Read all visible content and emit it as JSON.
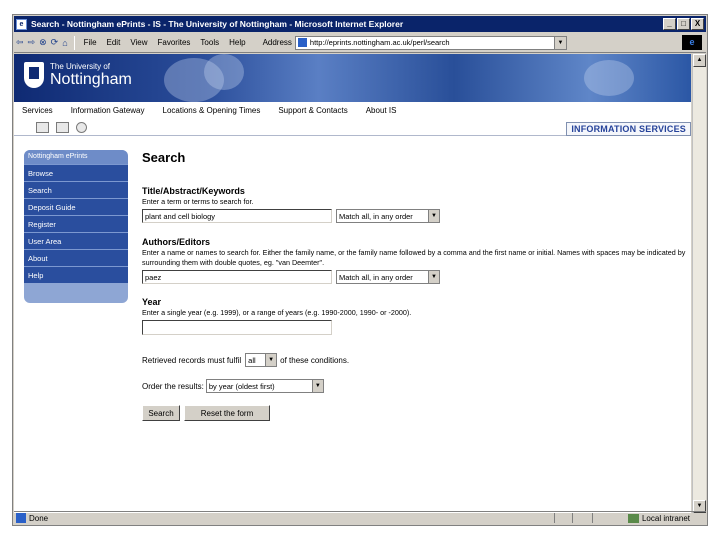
{
  "window": {
    "title": "Search - Nottingham ePrints - IS - The University of Nottingham - Microsoft Internet Explorer",
    "controls": [
      "_",
      "□",
      "X"
    ]
  },
  "toolbar": {
    "back": "⇦",
    "forward": "⇨",
    "stop": "⊗",
    "refresh": "⟳",
    "home": "⌂",
    "menus": [
      "File",
      "Edit",
      "View",
      "Favorites",
      "Tools",
      "Help"
    ],
    "address_label": "Address",
    "address_value": "http://eprints.nottingham.ac.uk/perl/search"
  },
  "banner": {
    "uni_top": "The University of",
    "uni_main": "Nottingham"
  },
  "linkbar": [
    "Services",
    "Information Gateway",
    "Locations & Opening Times",
    "Support & Contacts",
    "About IS"
  ],
  "is_label": "INFORMATION SERVICES",
  "sidebar": {
    "heading": "Nottingham ePrints",
    "items": [
      "Browse",
      "Search",
      "Deposit Guide",
      "Register",
      "User Area",
      "About",
      "Help"
    ]
  },
  "main": {
    "title": "Search",
    "title_section": {
      "heading": "Title/Abstract/Keywords",
      "help": "Enter a term or terms to search for.",
      "value": "plant and cell biology",
      "match": "Match all, in any order"
    },
    "authors_section": {
      "heading": "Authors/Editors",
      "help": "Enter a name or names to search for. Either the family name, or the family name followed by a comma and the first name or initial. Names with spaces may be indicated by surrounding them with double quotes, eg. \"van Deemter\".",
      "value": "paez",
      "match": "Match all, in any order"
    },
    "year_section": {
      "heading": "Year",
      "help": "Enter a single year (e.g. 1999), or a range of years (e.g. 1990-2000, 1990- or -2000).",
      "value": ""
    },
    "conditions": {
      "before": "Retrieved records must fulfil",
      "value": "all",
      "after": "of these conditions."
    },
    "order": {
      "label": "Order the results:",
      "value": "by year (oldest first)"
    },
    "buttons": {
      "search": "Search",
      "reset": "Reset the form"
    }
  },
  "status": {
    "text": "Done",
    "zone": "Local intranet"
  }
}
